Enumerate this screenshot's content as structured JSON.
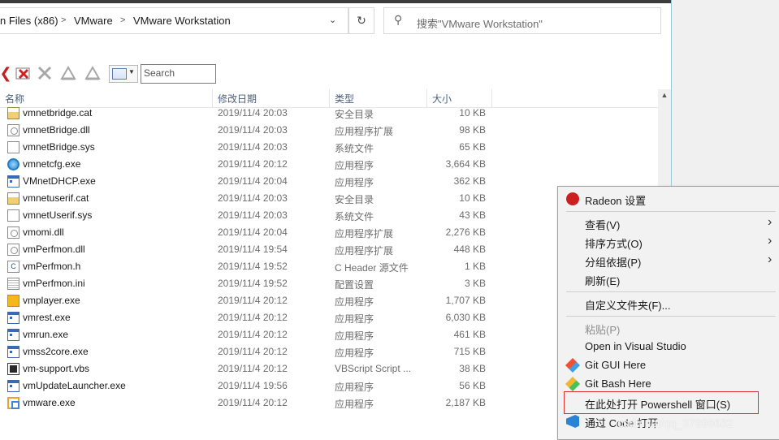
{
  "address": {
    "crumbs": [
      "n Files (x86)",
      "VMware",
      "VMware Workstation"
    ],
    "separator": ">",
    "dropdown_icon": "chevron-down",
    "refresh_icon": "refresh"
  },
  "search_box": {
    "placeholder": "搜索\"VMware Workstation\""
  },
  "toolbar": {
    "search_placeholder": "Search"
  },
  "columns": {
    "name": "名称",
    "date": "修改日期",
    "type": "类型",
    "size": "大小"
  },
  "files": [
    {
      "name": "vmnetbridge.cat",
      "date": "2019/11/4 20:03",
      "type": "安全目录",
      "size": "10 KB",
      "icon": "cat"
    },
    {
      "name": "vmnetBridge.dll",
      "date": "2019/11/4 20:03",
      "type": "应用程序扩展",
      "size": "98 KB",
      "icon": "dll"
    },
    {
      "name": "vmnetBridge.sys",
      "date": "2019/11/4 20:03",
      "type": "系统文件",
      "size": "65 KB",
      "icon": "sys"
    },
    {
      "name": "vmnetcfg.exe",
      "date": "2019/11/4 20:12",
      "type": "应用程序",
      "size": "3,664 KB",
      "icon": "globe"
    },
    {
      "name": "VMnetDHCP.exe",
      "date": "2019/11/4 20:04",
      "type": "应用程序",
      "size": "362 KB",
      "icon": "exe"
    },
    {
      "name": "vmnetuserif.cat",
      "date": "2019/11/4 20:03",
      "type": "安全目录",
      "size": "10 KB",
      "icon": "cat"
    },
    {
      "name": "vmnetUserif.sys",
      "date": "2019/11/4 20:03",
      "type": "系统文件",
      "size": "43 KB",
      "icon": "sys"
    },
    {
      "name": "vmomi.dll",
      "date": "2019/11/4 20:04",
      "type": "应用程序扩展",
      "size": "2,276 KB",
      "icon": "dll"
    },
    {
      "name": "vmPerfmon.dll",
      "date": "2019/11/4 19:54",
      "type": "应用程序扩展",
      "size": "448 KB",
      "icon": "dll"
    },
    {
      "name": "vmPerfmon.h",
      "date": "2019/11/4 19:52",
      "type": "C Header 源文件",
      "size": "1 KB",
      "icon": "h"
    },
    {
      "name": "vmPerfmon.ini",
      "date": "2019/11/4 19:52",
      "type": "配置设置",
      "size": "3 KB",
      "icon": "ini"
    },
    {
      "name": "vmplayer.exe",
      "date": "2019/11/4 20:12",
      "type": "应用程序",
      "size": "1,707 KB",
      "icon": "player"
    },
    {
      "name": "vmrest.exe",
      "date": "2019/11/4 20:12",
      "type": "应用程序",
      "size": "6,030 KB",
      "icon": "exe"
    },
    {
      "name": "vmrun.exe",
      "date": "2019/11/4 20:12",
      "type": "应用程序",
      "size": "461 KB",
      "icon": "exe"
    },
    {
      "name": "vmss2core.exe",
      "date": "2019/11/4 20:12",
      "type": "应用程序",
      "size": "715 KB",
      "icon": "exe"
    },
    {
      "name": "vm-support.vbs",
      "date": "2019/11/4 20:12",
      "type": "VBScript Script ...",
      "size": "38 KB",
      "icon": "vbs"
    },
    {
      "name": "vmUpdateLauncher.exe",
      "date": "2019/11/4 19:56",
      "type": "应用程序",
      "size": "56 KB",
      "icon": "exe"
    },
    {
      "name": "vmware.exe",
      "date": "2019/11/4 20:12",
      "type": "应用程序",
      "size": "2,187 KB",
      "icon": "vmware"
    }
  ],
  "context_menu": {
    "radeon": "Radeon 设置",
    "view": "查看(V)",
    "sort": "排序方式(O)",
    "group": "分组依据(P)",
    "refresh": "刷新(E)",
    "customize": "自定义文件夹(F)...",
    "paste": "粘贴(P)",
    "open_vs": "Open in Visual Studio",
    "git_gui": "Git GUI Here",
    "git_bash": "Git Bash Here",
    "powershell": "在此处打开 Powershell 窗口(S)",
    "vscode": "通过 Code 打开"
  },
  "watermark": "csdn.net/qq_37996632",
  "colors": {
    "highlight_border": "#e03030",
    "header_text": "#4c607a"
  }
}
